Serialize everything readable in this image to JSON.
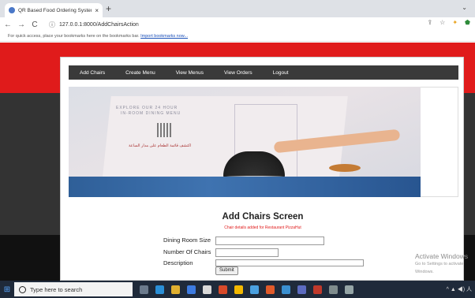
{
  "browser": {
    "tab_title": "QR Based Food Ordering System",
    "tab_close": "×",
    "new_tab": "+",
    "tab_menu": "⌄",
    "back": "←",
    "forward": "→",
    "reload": "C",
    "info_icon": "ⓘ",
    "url": "127.0.0.1:8000/AddChairsAction",
    "share_icon": "⇪",
    "star_icon": "☆",
    "ext1_icon": "✦",
    "ext2_icon": "⬟",
    "bookmarks_text": "For quick access, place your bookmarks here on the bookmarks bar.",
    "bookmarks_link": "Import bookmarks now..."
  },
  "menu": {
    "items": [
      "Add Chairs",
      "Create Menu",
      "View Menus",
      "View Orders",
      "Logout"
    ]
  },
  "hero": {
    "line1": "EXPLORE OUR 24 HOUR",
    "line2": "IN-ROOM DINING MENU",
    "arabic": "اكتشف قائمة الطعام على مدار الساعة"
  },
  "form": {
    "title": "Add Chairs Screen",
    "message": "Chair details added for Restaurant PizzaHut",
    "fields": [
      {
        "label": "Dining Room Size",
        "value": ""
      },
      {
        "label": "Number Of Chairs",
        "value": ""
      },
      {
        "label": "Description",
        "value": ""
      }
    ],
    "submit": "Submit"
  },
  "watermark": {
    "title": "Activate Windows",
    "subtitle": "Go to Settings to activate Windows."
  },
  "taskbar": {
    "start_icon": "⊞",
    "search_placeholder": "Type here to search",
    "tray": "^ ▲ ◀) 人"
  },
  "colors": {
    "header_red": "#e01b1b",
    "menu_bg": "#3a3a3a",
    "taskbar_bg": "#1f2a3a"
  }
}
